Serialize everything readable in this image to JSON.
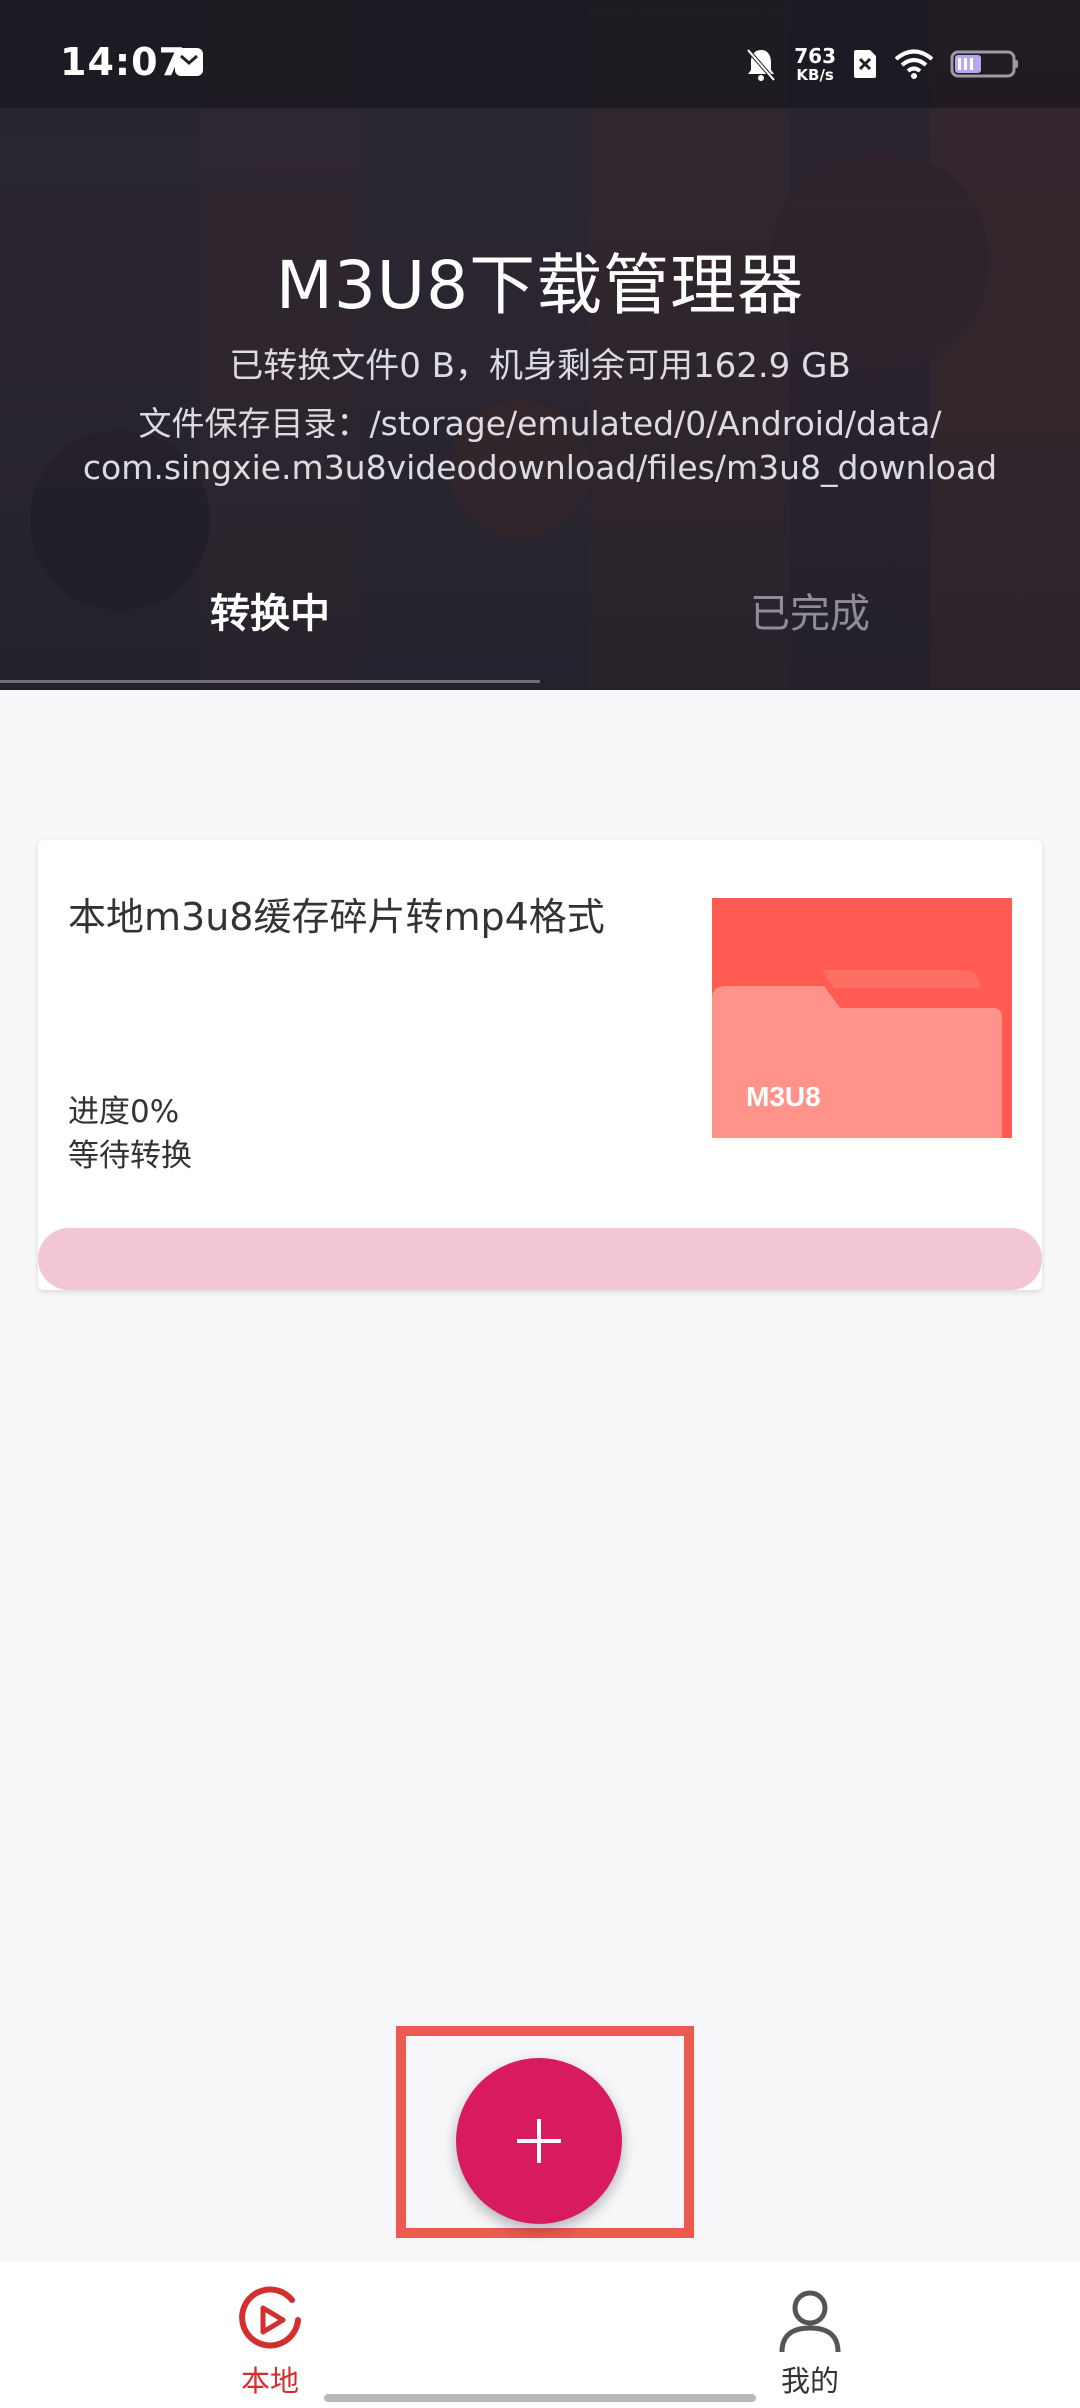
{
  "status_bar": {
    "time": "14:07",
    "net_speed_value": "763",
    "net_speed_unit": "KB/s",
    "icons": [
      "message-icon",
      "bell-muted-icon",
      "sim-off-icon",
      "wifi-icon",
      "battery-icon"
    ]
  },
  "header": {
    "title": "M3U8下载管理器",
    "storage_info": "已转换文件0 B，机身剩余可用162.9 GB",
    "save_dir_line1": "文件保存目录：/storage/emulated/0/Android/data/",
    "save_dir_line2": "com.singxie.m3u8videodownload/files/m3u8_download"
  },
  "tabs": [
    {
      "label": "转换中",
      "active": true
    },
    {
      "label": "已完成",
      "active": false
    }
  ],
  "task": {
    "title": "本地m3u8缓存碎片转mp4格式",
    "progress_text": "进度0%",
    "progress_value": 0,
    "status": "等待转换",
    "thumb_label": "M3U8"
  },
  "fab": {
    "icon": "plus-icon"
  },
  "bottom_nav": [
    {
      "label": "本地",
      "icon": "play-circle-icon",
      "active": true
    },
    {
      "label": "我的",
      "icon": "person-icon",
      "active": false
    }
  ],
  "colors": {
    "accent": "#d81b60",
    "nav_active": "#d32f2f",
    "thumb_bg": "#ff5b52",
    "progress_track": "#f3c6d6",
    "highlight_box": "#ee5a52"
  }
}
